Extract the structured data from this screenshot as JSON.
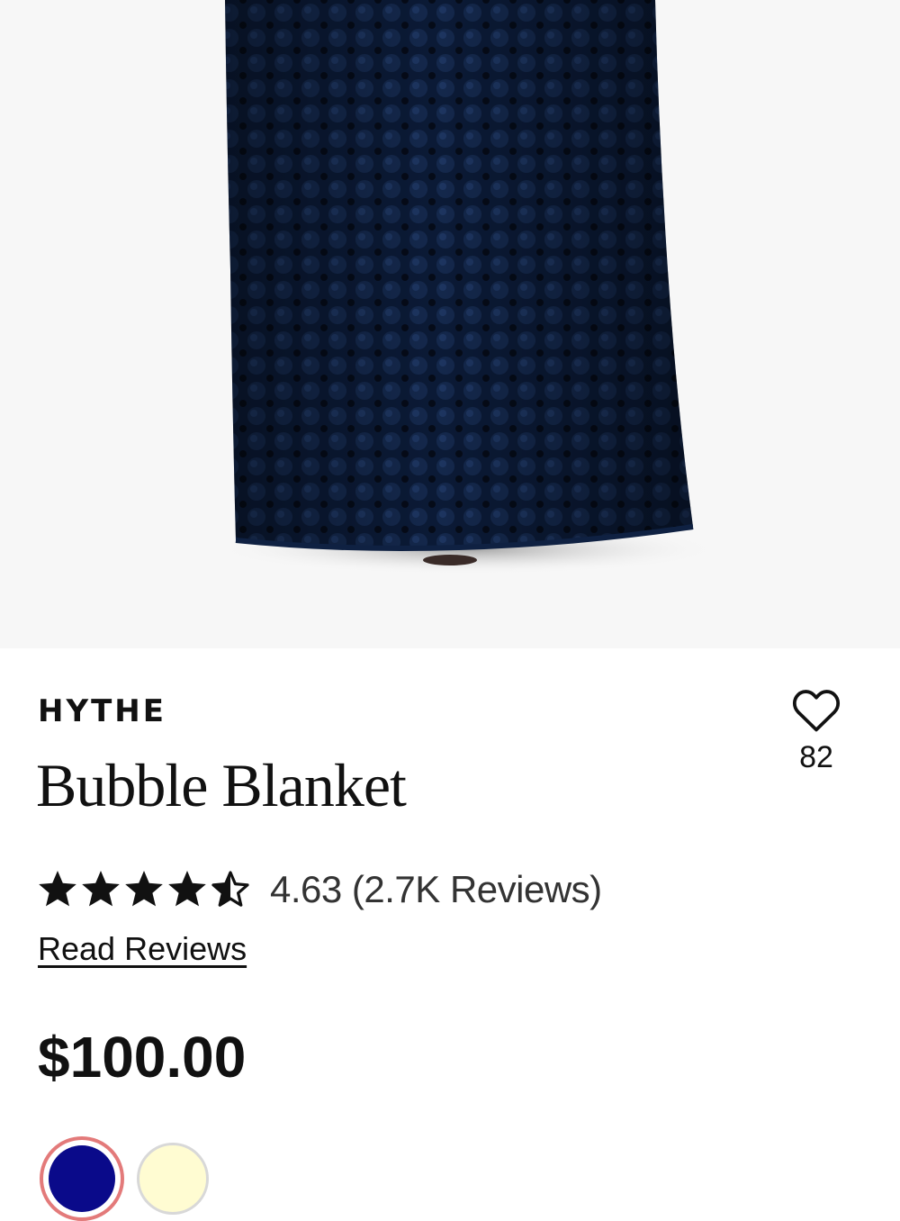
{
  "product": {
    "brand": "HYTHE",
    "name": "Bubble Blanket",
    "favorites_count": "82",
    "rating_value": 4.63,
    "rating_text": "4.63 (2.7K Reviews)",
    "read_reviews_label": "Read Reviews",
    "price": "$100.00"
  },
  "image": {
    "subject": "person holding up a navy bubble-texture blanket"
  },
  "swatches": [
    {
      "color_name": "navy",
      "hex": "#0a0a8a",
      "selected": true
    },
    {
      "color_name": "cream",
      "hex": "#fffcd2",
      "selected": false
    }
  ],
  "colors": {
    "swatch_selected_ring": "#e37a7a",
    "hero_background": "#f7f7f7",
    "blanket": "#0b1a36"
  },
  "icons": {
    "favorite": "heart-outline-icon",
    "star_full": "star-icon",
    "star_half": "star-half-icon"
  }
}
